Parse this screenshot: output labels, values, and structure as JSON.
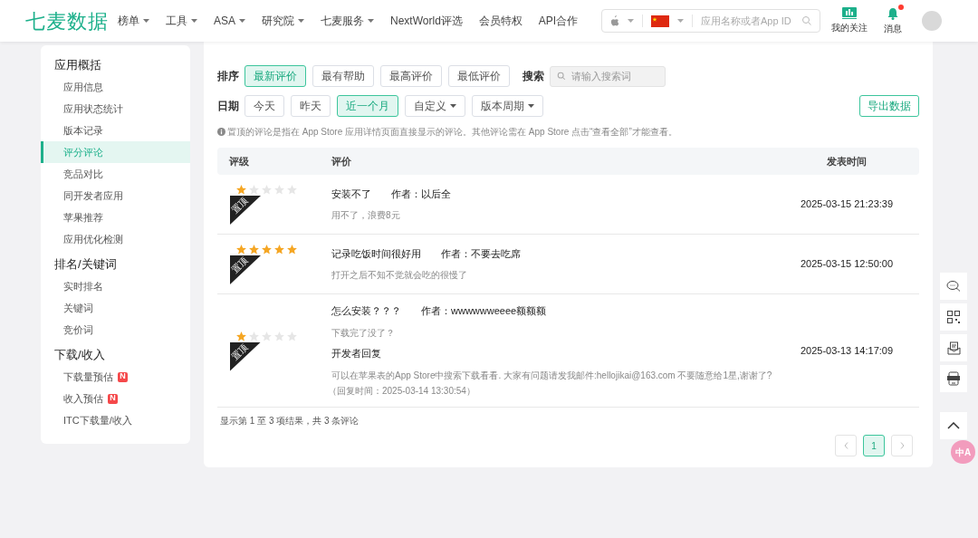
{
  "header": {
    "logo": "七麦数据",
    "nav": [
      {
        "label": "榜单",
        "dropdown": true
      },
      {
        "label": "工具",
        "dropdown": true
      },
      {
        "label": "ASA",
        "dropdown": true
      },
      {
        "label": "研究院",
        "dropdown": true
      },
      {
        "label": "七麦服务",
        "dropdown": true
      },
      {
        "label": "NextWorld评选",
        "dropdown": false
      },
      {
        "label": "会员特权",
        "dropdown": false
      },
      {
        "label": "API合作",
        "dropdown": false
      }
    ],
    "search": {
      "placeholder": "应用名称或者App ID"
    },
    "actions": [
      {
        "kind": "follow",
        "label": "我的关注",
        "unread": false
      },
      {
        "kind": "messages",
        "label": "消息",
        "unread": true
      }
    ]
  },
  "sidebar": {
    "sections": [
      {
        "title": "应用概括",
        "items": [
          {
            "label": "应用信息",
            "selected": false
          },
          {
            "label": "应用状态统计",
            "selected": false
          },
          {
            "label": "版本记录",
            "selected": false
          },
          {
            "label": "评分评论",
            "selected": true
          },
          {
            "label": "竞品对比",
            "selected": false
          },
          {
            "label": "同开发者应用",
            "selected": false
          },
          {
            "label": "苹果推荐",
            "selected": false
          },
          {
            "label": "应用优化检测",
            "selected": false
          }
        ]
      },
      {
        "title": "排名/关键词",
        "items": [
          {
            "label": "实时排名",
            "selected": false
          },
          {
            "label": "关键词",
            "selected": false
          },
          {
            "label": "竞价词",
            "selected": false
          }
        ]
      },
      {
        "title": "下载/收入",
        "items": [
          {
            "label": "下载量预估",
            "selected": false,
            "badge": "N"
          },
          {
            "label": "收入预估",
            "selected": false,
            "badge": "N"
          },
          {
            "label": "ITC下载量/收入",
            "selected": false
          }
        ]
      }
    ]
  },
  "filters": {
    "sort": {
      "label": "排序",
      "options": [
        {
          "label": "最新评价",
          "selected": true
        },
        {
          "label": "最有帮助",
          "selected": false
        },
        {
          "label": "最高评价",
          "selected": false
        },
        {
          "label": "最低评价",
          "selected": false
        }
      ]
    },
    "search": {
      "label": "搜索",
      "placeholder": "请输入搜索词"
    },
    "date": {
      "label": "日期",
      "options": [
        {
          "label": "今天",
          "selected": false,
          "dropdown": false
        },
        {
          "label": "昨天",
          "selected": false,
          "dropdown": false
        },
        {
          "label": "近一个月",
          "selected": true,
          "dropdown": false
        },
        {
          "label": "自定义",
          "selected": false,
          "dropdown": true
        },
        {
          "label": "版本周期",
          "selected": false,
          "dropdown": true
        }
      ]
    },
    "export_button": "导出数据"
  },
  "note": "置顶的评论是指在 App Store 应用详情页面直接显示的评论。其他评论需在 App Store 点击“查看全部”才能查看。",
  "table": {
    "columns": [
      "评级",
      "评价",
      "发表时间"
    ],
    "rows": [
      {
        "stars": 1,
        "pinned": true,
        "pin_label": "置顶",
        "title": "安装不了",
        "author": "作者：以后全",
        "body": "用不了，浪费8元",
        "time": "2025-03-15 21:23:39"
      },
      {
        "stars": 5,
        "pinned": true,
        "pin_label": "置顶",
        "title": "记录吃饭时间很好用",
        "author": "作者：不要去吃席",
        "body": "打开之后不知不觉就会吃的很慢了",
        "time": "2025-03-15 12:50:00"
      },
      {
        "stars": 1,
        "pinned": true,
        "pin_label": "置顶",
        "title": "怎么安装？？？",
        "author": "作者：wwwwwweeee额额额",
        "body": "下载完了没了？",
        "reply": {
          "title": "开发者回复",
          "body": "可以在苹果表的App Store中搜索下载看看. 大家有问题请发我邮件:hellojikai@163.com 不要随意给1星,谢谢了?",
          "time": "（回复时间：2025-03-14 13:30:54）"
        },
        "time": "2025-03-13 14:17:09"
      }
    ]
  },
  "summary": "显示第 1 至 3 项结果，共 3 条评论",
  "pagination": {
    "pages": [
      {
        "label": "1",
        "selected": true
      }
    ]
  },
  "floating_tools": {
    "translate": "中A"
  }
}
